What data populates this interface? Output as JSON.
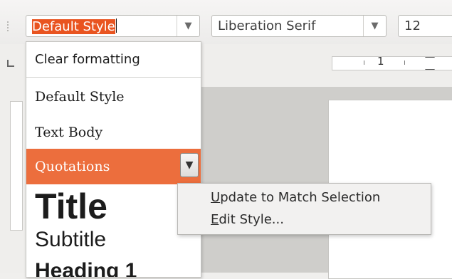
{
  "toolbar": {
    "paragraph_style": {
      "value": "Default Style"
    },
    "font_name": {
      "value": "Liberation Serif"
    },
    "font_size": {
      "value": "12"
    }
  },
  "ruler": {
    "mark": "1"
  },
  "style_list": {
    "items": [
      {
        "label": "Clear formatting"
      },
      {
        "label": "Default Style"
      },
      {
        "label": "Text Body"
      },
      {
        "label": "Quotations"
      },
      {
        "label": "Title"
      },
      {
        "label": "Subtitle"
      },
      {
        "label": "Heading 1"
      }
    ]
  },
  "context_menu": {
    "update": {
      "mnemonic": "U",
      "rest": "pdate to Match Selection"
    },
    "edit": {
      "mnemonic": "E",
      "rest": "dit Style..."
    }
  },
  "colors": {
    "highlight": "#ec6e3d",
    "selection": "#e95420"
  },
  "icons": {
    "dropdown": "chevron-down-icon",
    "menu": "triangle-down-icon"
  }
}
